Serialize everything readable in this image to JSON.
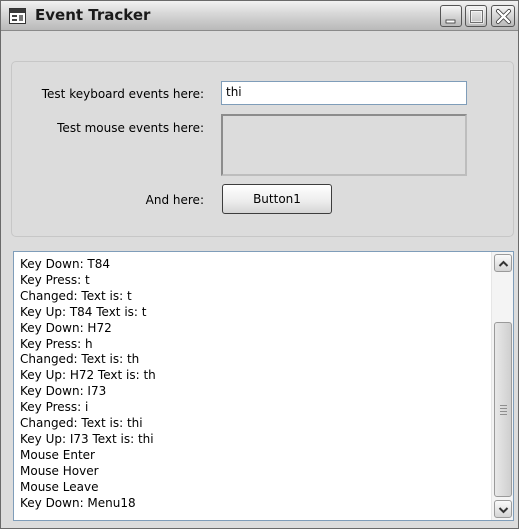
{
  "window": {
    "title": "Event Tracker"
  },
  "form": {
    "keyboard_label": "Test keyboard events here:",
    "keyboard_value": "thi",
    "mouse_label": "Test mouse events here:",
    "button_label": "And here:",
    "button_text": "Button1"
  },
  "log": {
    "lines": [
      "Key Down: T84",
      "Key Press: t",
      "Changed:  Text is: t",
      "Key Up: T84 Text is: t",
      "Key Down: H72",
      "Key Press: h",
      "Changed:  Text is: th",
      "Key Up: H72 Text is: th",
      "Key Down: I73",
      "Key Press: i",
      "Changed:  Text is: thi",
      "Key Up: I73 Text is: thi",
      "Mouse Enter",
      "Mouse Hover",
      "Mouse Leave",
      "Key Down: Menu18"
    ]
  },
  "icons": {
    "app": "app-window-icon",
    "minimize": "minimize-icon",
    "maximize": "maximize-icon",
    "close": "close-icon",
    "scroll_up": "chevron-up-icon",
    "scroll_down": "chevron-down-icon"
  }
}
